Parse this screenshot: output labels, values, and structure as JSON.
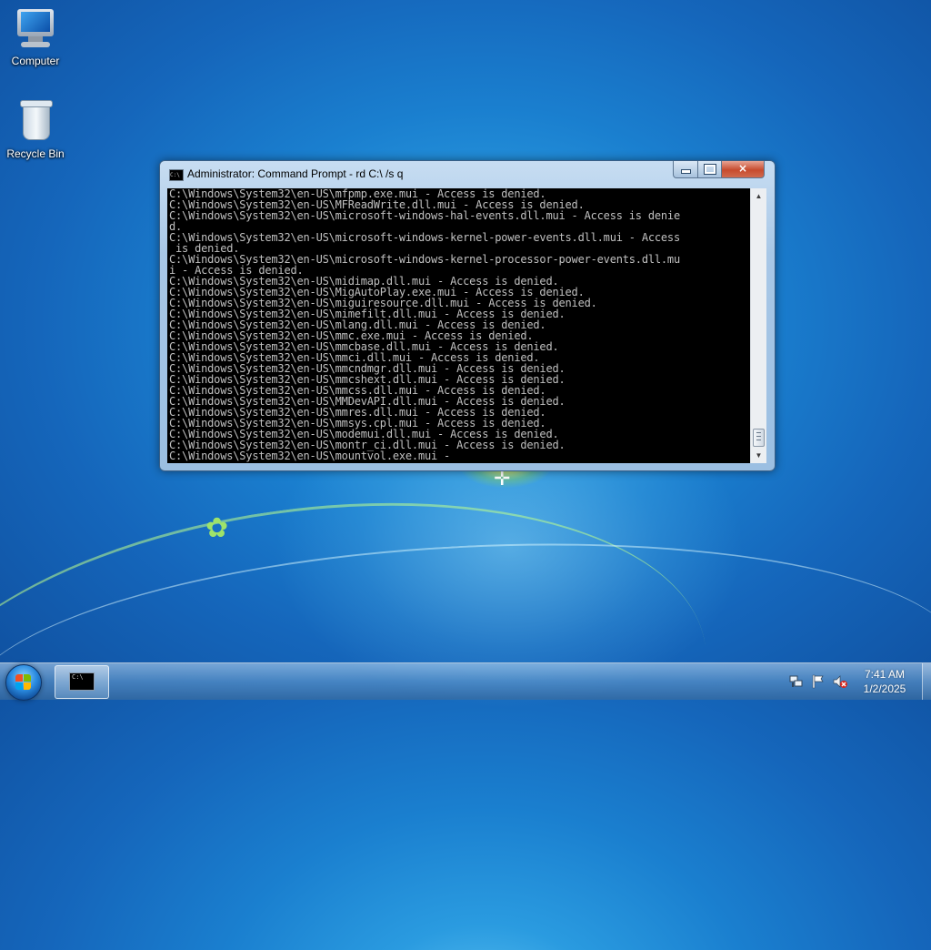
{
  "desktop": {
    "icons": [
      {
        "label": "Computer",
        "icon": "computer-icon"
      },
      {
        "label": "Recycle Bin",
        "icon": "recycle-bin-icon"
      }
    ]
  },
  "window": {
    "title": "Administrator:  Command Prompt - rd  C:\\ /s q",
    "icon": "cmd-icon",
    "icon_text": "C:\\",
    "controls": {
      "minimize": "minimize",
      "maximize": "maximize",
      "close": "×"
    },
    "console_lines": [
      "C:\\Windows\\System32\\en-US\\mfpmp.exe.mui - Access is denied.",
      "C:\\Windows\\System32\\en-US\\MFReadWrite.dll.mui - Access is denied.",
      "C:\\Windows\\System32\\en-US\\microsoft-windows-hal-events.dll.mui - Access is denie",
      "d.",
      "C:\\Windows\\System32\\en-US\\microsoft-windows-kernel-power-events.dll.mui - Access",
      " is denied.",
      "C:\\Windows\\System32\\en-US\\microsoft-windows-kernel-processor-power-events.dll.mu",
      "i - Access is denied.",
      "C:\\Windows\\System32\\en-US\\midimap.dll.mui - Access is denied.",
      "C:\\Windows\\System32\\en-US\\MigAutoPlay.exe.mui - Access is denied.",
      "C:\\Windows\\System32\\en-US\\miguiresource.dll.mui - Access is denied.",
      "C:\\Windows\\System32\\en-US\\mimefilt.dll.mui - Access is denied.",
      "C:\\Windows\\System32\\en-US\\mlang.dll.mui - Access is denied.",
      "C:\\Windows\\System32\\en-US\\mmc.exe.mui - Access is denied.",
      "C:\\Windows\\System32\\en-US\\mmcbase.dll.mui - Access is denied.",
      "C:\\Windows\\System32\\en-US\\mmci.dll.mui - Access is denied.",
      "C:\\Windows\\System32\\en-US\\mmcndmgr.dll.mui - Access is denied.",
      "C:\\Windows\\System32\\en-US\\mmcshext.dll.mui - Access is denied.",
      "C:\\Windows\\System32\\en-US\\mmcss.dll.mui - Access is denied.",
      "C:\\Windows\\System32\\en-US\\MMDevAPI.dll.mui - Access is denied.",
      "C:\\Windows\\System32\\en-US\\mmres.dll.mui - Access is denied.",
      "C:\\Windows\\System32\\en-US\\mmsys.cpl.mui - Access is denied.",
      "C:\\Windows\\System32\\en-US\\modemui.dll.mui - Access is denied.",
      "C:\\Windows\\System32\\en-US\\montr_ci.dll.mui - Access is denied.",
      "C:\\Windows\\System32\\en-US\\mountvol.exe.mui -"
    ]
  },
  "taskbar": {
    "start_icon": "windows-logo-icon",
    "pinned": [
      {
        "icon": "cmd-icon",
        "icon_text": "C:\\"
      }
    ],
    "tray_icons": [
      "network-icon",
      "action-center-flag-icon",
      "volume-muted-icon"
    ],
    "time": "7:41 AM",
    "date": "1/2/2025"
  },
  "colors": {
    "console_bg": "#000000",
    "console_text": "#c0c0c0",
    "close_button": "#c74b2e",
    "desktop_blue": "#1a7fcf"
  }
}
